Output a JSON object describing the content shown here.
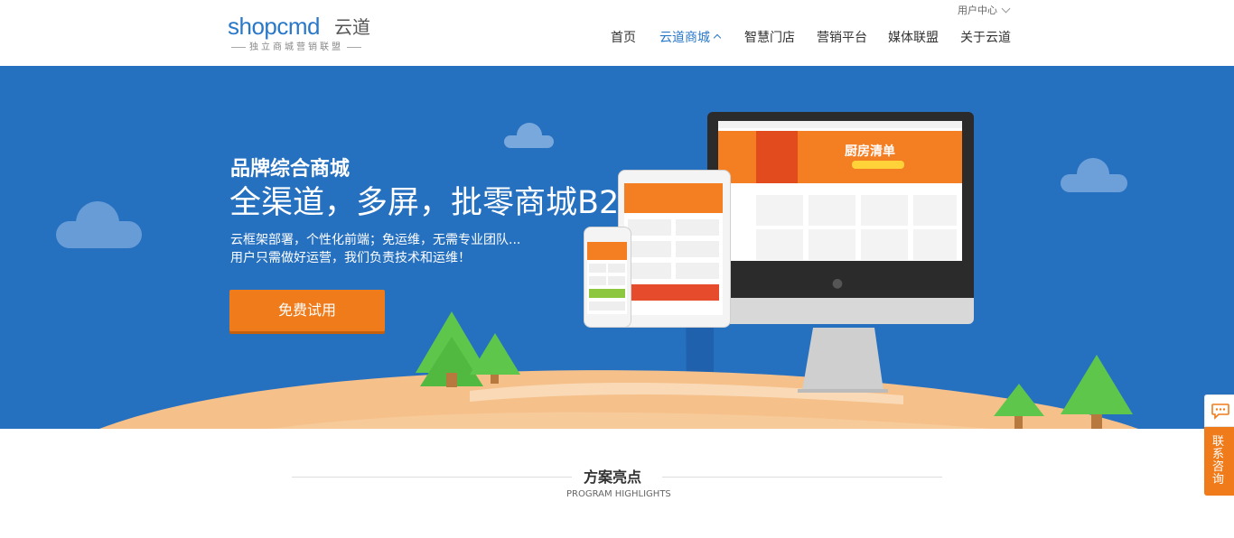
{
  "header": {
    "logo_word": "shopcmd",
    "logo_cn": "云道",
    "logo_tagline": "独立商城营销联盟",
    "user_center": "用户中心",
    "nav": [
      {
        "label": "首页",
        "active": false
      },
      {
        "label": "云道商城",
        "active": true
      },
      {
        "label": "智慧门店",
        "active": false
      },
      {
        "label": "营销平台",
        "active": false
      },
      {
        "label": "媒体联盟",
        "active": false
      },
      {
        "label": "关于云道",
        "active": false
      }
    ]
  },
  "banner": {
    "subtitle": "品牌综合商城",
    "title": "全渠道，多屏，批零商城B2C",
    "desc_line1": "云框架部署，个性化前端；免运维，无需专业团队...",
    "desc_line2": "用户只需做好运营，我们负责技术和运维！",
    "cta_label": "免费试用",
    "screen_promo": "厨房清单",
    "colors": {
      "background": "#2670c0",
      "cta": "#f07b1a",
      "ground": "#f5c08a",
      "tree": "#5ec64a"
    }
  },
  "section": {
    "title": "方案亮点",
    "subtitle": "PROGRAM HIGHLIGHTS"
  },
  "float_consult": {
    "label": "联系咨询",
    "icon": "chat-icon"
  }
}
